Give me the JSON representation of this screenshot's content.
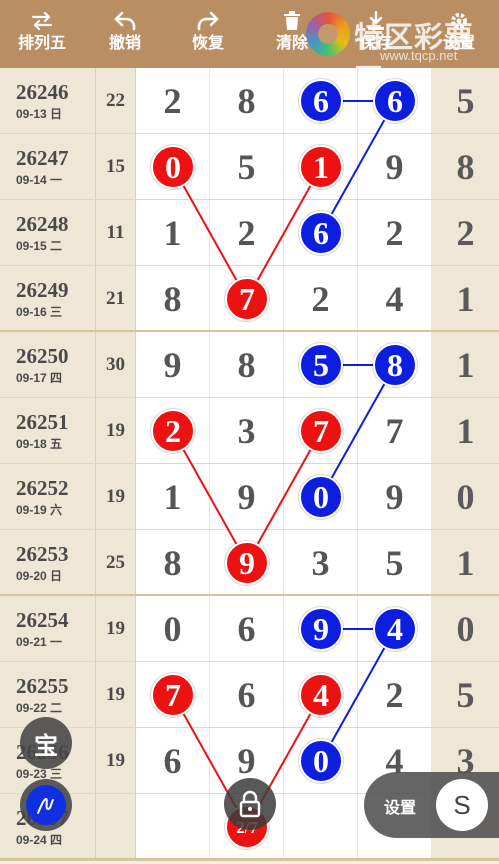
{
  "toolbar": {
    "sort_label": "排列五",
    "undo_label": "撤销",
    "redo_label": "恢复",
    "clear_label": "清除",
    "save_label": "保存",
    "settings_label": "设置"
  },
  "logo": {
    "name": "特区彩票网",
    "url": "www.tqcp.net"
  },
  "table": {
    "rows": [
      {
        "issue": "26246",
        "date": "09-13 日",
        "sum": "22",
        "digits": [
          "2",
          "8",
          "6",
          "6",
          "5"
        ]
      },
      {
        "issue": "26247",
        "date": "09-14 一",
        "sum": "15",
        "digits": [
          "0",
          "5",
          "1",
          "9",
          "8"
        ]
      },
      {
        "issue": "26248",
        "date": "09-15 二",
        "sum": "11",
        "digits": [
          "1",
          "2",
          "6",
          "2",
          "2"
        ]
      },
      {
        "issue": "26249",
        "date": "09-16 三",
        "sum": "21",
        "digits": [
          "8",
          "7",
          "2",
          "4",
          "1"
        ]
      },
      {
        "issue": "26250",
        "date": "09-17 四",
        "sum": "30",
        "digits": [
          "9",
          "8",
          "5",
          "8",
          "1"
        ]
      },
      {
        "issue": "26251",
        "date": "09-18 五",
        "sum": "19",
        "digits": [
          "2",
          "3",
          "7",
          "7",
          "1"
        ]
      },
      {
        "issue": "26252",
        "date": "09-19 六",
        "sum": "19",
        "digits": [
          "1",
          "9",
          "0",
          "9",
          "0"
        ]
      },
      {
        "issue": "26253",
        "date": "09-20 日",
        "sum": "25",
        "digits": [
          "8",
          "9",
          "3",
          "5",
          "1"
        ]
      },
      {
        "issue": "26254",
        "date": "09-21 一",
        "sum": "19",
        "digits": [
          "0",
          "6",
          "9",
          "4",
          "0"
        ]
      },
      {
        "issue": "26255",
        "date": "09-22 二",
        "sum": "19",
        "digits": [
          "7",
          "6",
          "4",
          "2",
          "5"
        ]
      },
      {
        "issue": "26256",
        "date": "09-23 三",
        "sum": "19",
        "digits": [
          "6",
          "9",
          "0",
          "4",
          "3"
        ]
      },
      {
        "issue": "26257",
        "date": "09-24 四",
        "sum": "",
        "digits": [
          "",
          "",
          "",
          "",
          ""
        ]
      }
    ],
    "marks": [
      {
        "row": 0,
        "col": 2,
        "color": "blue",
        "value": "6"
      },
      {
        "row": 0,
        "col": 3,
        "color": "blue",
        "value": "6"
      },
      {
        "row": 1,
        "col": 0,
        "color": "red",
        "value": "0"
      },
      {
        "row": 1,
        "col": 2,
        "color": "red",
        "value": "1"
      },
      {
        "row": 2,
        "col": 2,
        "color": "blue",
        "value": "6"
      },
      {
        "row": 3,
        "col": 1,
        "color": "red",
        "value": "7"
      },
      {
        "row": 4,
        "col": 2,
        "color": "blue",
        "value": "5"
      },
      {
        "row": 4,
        "col": 3,
        "color": "blue",
        "value": "8"
      },
      {
        "row": 5,
        "col": 0,
        "color": "red",
        "value": "2"
      },
      {
        "row": 5,
        "col": 2,
        "color": "red",
        "value": "7"
      },
      {
        "row": 6,
        "col": 2,
        "color": "blue",
        "value": "0"
      },
      {
        "row": 7,
        "col": 1,
        "color": "red",
        "value": "9"
      },
      {
        "row": 8,
        "col": 2,
        "color": "blue",
        "value": "9"
      },
      {
        "row": 8,
        "col": 3,
        "color": "blue",
        "value": "4"
      },
      {
        "row": 9,
        "col": 0,
        "color": "red",
        "value": "7"
      },
      {
        "row": 9,
        "col": 2,
        "color": "red",
        "value": "4"
      },
      {
        "row": 10,
        "col": 2,
        "color": "blue",
        "value": "0"
      },
      {
        "row": 11,
        "col": 1,
        "color": "red",
        "value": "2/7"
      }
    ],
    "links": [
      {
        "from": [
          0,
          2
        ],
        "to": [
          0,
          3
        ],
        "color": "blue"
      },
      {
        "from": [
          0,
          3
        ],
        "to": [
          2,
          2
        ],
        "color": "blue"
      },
      {
        "from": [
          1,
          0
        ],
        "to": [
          3,
          1
        ],
        "color": "red"
      },
      {
        "from": [
          1,
          2
        ],
        "to": [
          3,
          1
        ],
        "color": "red"
      },
      {
        "from": [
          4,
          2
        ],
        "to": [
          4,
          3
        ],
        "color": "blue"
      },
      {
        "from": [
          4,
          3
        ],
        "to": [
          6,
          2
        ],
        "color": "blue"
      },
      {
        "from": [
          5,
          0
        ],
        "to": [
          7,
          1
        ],
        "color": "red"
      },
      {
        "from": [
          5,
          2
        ],
        "to": [
          7,
          1
        ],
        "color": "red"
      },
      {
        "from": [
          8,
          2
        ],
        "to": [
          8,
          3
        ],
        "color": "blue"
      },
      {
        "from": [
          8,
          3
        ],
        "to": [
          10,
          2
        ],
        "color": "blue"
      },
      {
        "from": [
          9,
          0
        ],
        "to": [
          11,
          1
        ],
        "color": "red"
      },
      {
        "from": [
          9,
          2
        ],
        "to": [
          11,
          1
        ],
        "color": "red"
      }
    ]
  },
  "floating": {
    "bao_label": "宝",
    "settings_label": "设置",
    "s_label": "S",
    "pen_icon": "pen-icon",
    "lock_icon": "lock-icon"
  },
  "colors": {
    "red": "#ee1111",
    "blue": "#0d1ee0",
    "toolbar": "#b98e63"
  }
}
